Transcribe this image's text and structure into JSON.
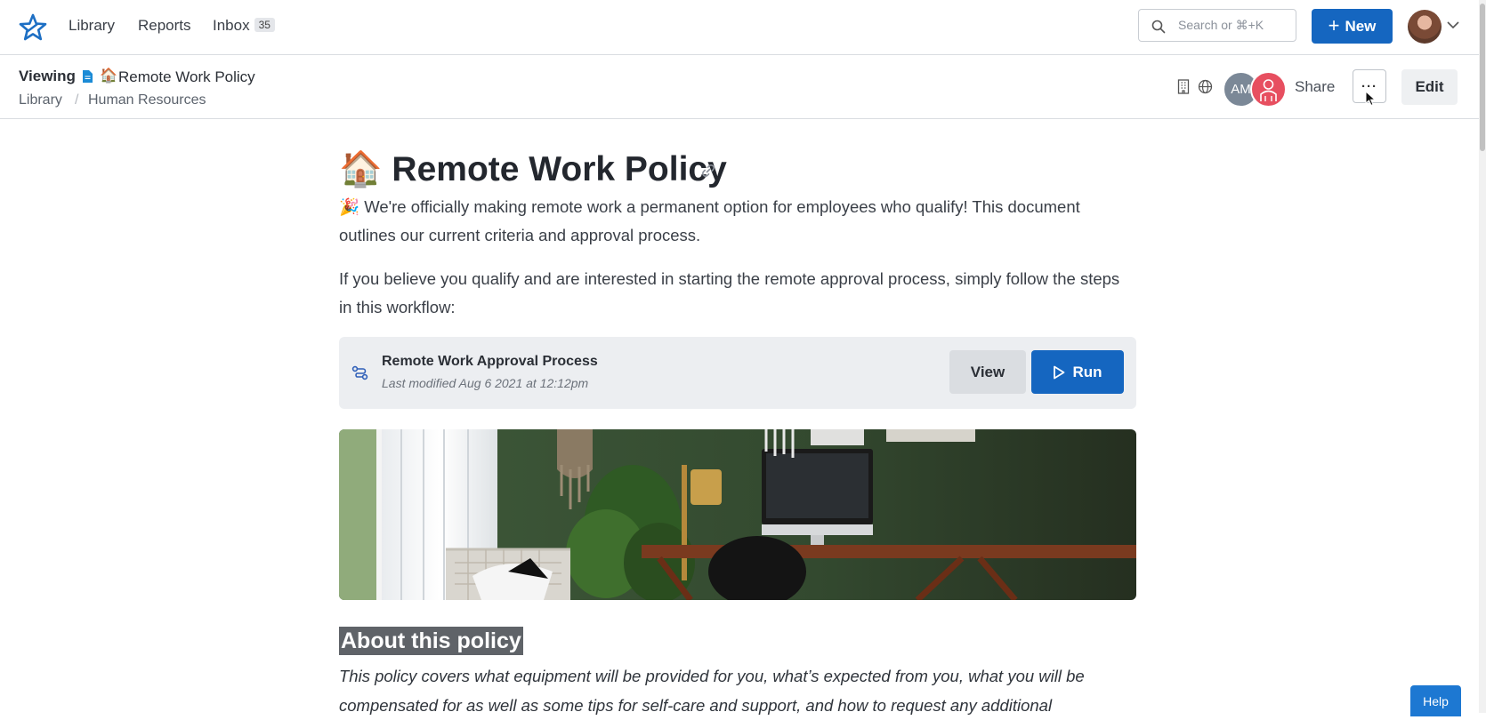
{
  "topnav": {
    "items": [
      {
        "label": "Library"
      },
      {
        "label": "Reports"
      },
      {
        "label": "Inbox",
        "badge": "35"
      }
    ],
    "search_placeholder": "Search or ⌘+K",
    "new_label": "New",
    "new_icon": "plus-icon",
    "user_icon": "user-avatar"
  },
  "header": {
    "viewing_label": "Viewing",
    "doc_emoji": "🏠",
    "doc_title": "Remote Work Policy",
    "breadcrumb": [
      "Library",
      "Human Resources"
    ],
    "collaborator_initials": "AM",
    "share_label": "Share",
    "more_label": "···",
    "edit_label": "Edit"
  },
  "document": {
    "title_emoji": "🏠",
    "title": "Remote Work Policy",
    "intro_emoji": "🎉",
    "intro": "We're officially making remote work a permanent option for employees who qualify! This document outlines our current criteria and approval process.",
    "instructions": "If you believe you qualify and are interested in starting the remote approval process, simply follow the steps in this workflow:",
    "workflow": {
      "title": "Remote Work Approval Process",
      "modified": "Last modified Aug 6 2021 at 12:12pm",
      "view_label": "View",
      "run_label": "Run"
    },
    "about_heading": "About this policy",
    "about_text": "This policy covers what equipment will be provided for you, what’s expected from you, what you will be compensated for as well as some tips for self-care and support, and how to request any additional"
  },
  "help_label": "Help",
  "colors": {
    "primary": "#1566c0",
    "avatar_am": "#7b8897",
    "avatar_group": "#e74f60",
    "heading_highlight": "#5f6368"
  }
}
